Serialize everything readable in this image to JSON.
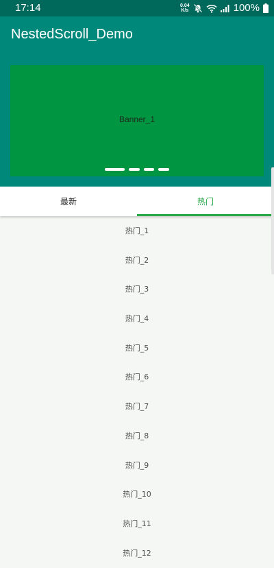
{
  "status_bar": {
    "time": "17:14",
    "net_speed_value": "0.04",
    "net_speed_unit": "K/s",
    "battery": "100%",
    "icons": [
      "mute-icon",
      "wifi-icon",
      "signal-icon",
      "battery-icon"
    ]
  },
  "app_bar": {
    "title": "NestedScroll_Demo"
  },
  "banner": {
    "label": "Banner_1",
    "page_count": 4,
    "active_page": 1
  },
  "tabs": [
    {
      "label": "最新",
      "selected": false
    },
    {
      "label": "热门",
      "selected": true
    }
  ],
  "list": {
    "items": [
      "热门_1",
      "热门_2",
      "热门_3",
      "热门_4",
      "热门_5",
      "热门_6",
      "热门_7",
      "热门_8",
      "热门_9",
      "热门_10",
      "热门_11",
      "热门_12"
    ]
  },
  "colors": {
    "status_bar": "#00695c",
    "primary": "#00897b",
    "banner": "#009641",
    "accent": "#2aa84a",
    "background": "#f5f7f4"
  }
}
